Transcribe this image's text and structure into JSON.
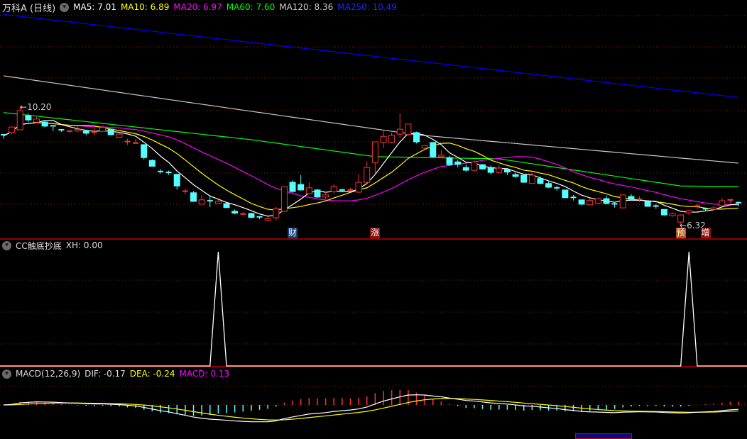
{
  "header": {
    "title": "万科A (日线)",
    "ma5": "MA5: 7.01",
    "ma10": "MA10: 6.89",
    "ma20": "MA20: 6.97",
    "ma60": "MA60: 7.60",
    "ma120": "MA120: 8.36",
    "ma250": "MA250: 10.49"
  },
  "indicator": {
    "title": "CC触底抄底",
    "xh": "XH: 0.00"
  },
  "macd": {
    "title": "MACD(12,26,9)",
    "dif": "DIF: -0.17",
    "dea": "DEA: -0.24",
    "macd": "MACD: 0.13"
  },
  "annotations": {
    "high": "10.20",
    "low": "6.32"
  },
  "event_tags": [
    {
      "text": "财",
      "index": 35,
      "color": "#14417a"
    },
    {
      "text": "涨",
      "index": 45,
      "color": "#8a1010"
    },
    {
      "text": "预",
      "index": 82,
      "color": "#b8520c"
    },
    {
      "text": "增",
      "index": 85,
      "color": "#8a1010"
    }
  ],
  "colors": {
    "up": "#ff3232",
    "down": "#54ffff",
    "ma5": "#ffffff",
    "ma10": "#ffff00",
    "ma20": "#ff00ff",
    "ma60": "#00ff00",
    "ma120": "#c8c8c8",
    "ma250": "#0000ff",
    "grid": "#8b1a1a"
  },
  "chart_data": {
    "type": "candlestick",
    "candles_ohlc": [
      [
        9.28,
        9.3,
        9.15,
        9.24
      ],
      [
        9.35,
        9.55,
        9.3,
        9.53
      ],
      [
        9.44,
        10.2,
        9.42,
        10.06
      ],
      [
        9.9,
        9.97,
        9.7,
        9.76
      ],
      [
        9.69,
        9.85,
        9.67,
        9.79
      ],
      [
        9.69,
        9.76,
        9.52,
        9.56
      ],
      [
        9.57,
        9.57,
        9.4,
        9.55
      ],
      [
        9.44,
        9.47,
        9.37,
        9.4
      ],
      [
        9.36,
        9.41,
        9.33,
        9.4
      ],
      [
        9.4,
        9.55,
        9.38,
        9.45
      ],
      [
        9.4,
        9.42,
        9.26,
        9.33
      ],
      [
        9.33,
        9.5,
        9.28,
        9.37
      ],
      [
        9.39,
        9.56,
        9.38,
        9.52
      ],
      [
        9.46,
        9.46,
        9.26,
        9.28
      ],
      [
        9.2,
        9.33,
        9.19,
        9.3
      ],
      [
        9.04,
        9.15,
        8.95,
        9.06
      ],
      [
        8.99,
        9.15,
        8.99,
        9.01
      ],
      [
        8.96,
        8.96,
        8.48,
        8.54
      ],
      [
        8.45,
        8.48,
        8.26,
        8.26
      ],
      [
        8.09,
        8.17,
        8.02,
        8.07
      ],
      [
        8.06,
        8.12,
        7.98,
        8.04
      ],
      [
        8.0,
        8.0,
        7.5,
        7.62
      ],
      [
        7.43,
        7.53,
        7.35,
        7.45
      ],
      [
        7.4,
        7.45,
        7.12,
        7.12
      ],
      [
        7.03,
        7.32,
        7.03,
        7.17
      ],
      [
        7.14,
        7.32,
        6.93,
        7.11
      ],
      [
        7.05,
        7.18,
        7.05,
        7.12
      ],
      [
        7.05,
        7.05,
        6.9,
        6.92
      ],
      [
        6.8,
        6.86,
        6.7,
        6.74
      ],
      [
        6.69,
        6.78,
        6.69,
        6.71
      ],
      [
        6.73,
        6.75,
        6.58,
        6.6
      ],
      [
        6.62,
        6.64,
        6.54,
        6.6
      ],
      [
        6.5,
        6.62,
        6.5,
        6.56
      ],
      [
        6.59,
        6.95,
        6.5,
        6.88
      ],
      [
        6.8,
        7.6,
        6.78,
        7.6
      ],
      [
        7.74,
        7.8,
        7.4,
        7.44
      ],
      [
        7.67,
        7.97,
        7.47,
        7.49
      ],
      [
        7.37,
        7.74,
        7.35,
        7.56
      ],
      [
        7.49,
        7.53,
        7.24,
        7.26
      ],
      [
        7.26,
        7.42,
        7.2,
        7.33
      ],
      [
        7.44,
        7.67,
        7.37,
        7.6
      ],
      [
        7.49,
        7.53,
        7.42,
        7.46
      ],
      [
        7.47,
        7.56,
        7.44,
        7.49
      ],
      [
        7.42,
        8.0,
        7.4,
        7.74
      ],
      [
        7.74,
        8.42,
        7.7,
        8.22
      ],
      [
        8.38,
        9.05,
        8.0,
        9.05
      ],
      [
        9.03,
        9.45,
        8.85,
        9.23
      ],
      [
        9.03,
        9.35,
        9.0,
        9.26
      ],
      [
        9.3,
        9.97,
        9.18,
        9.46
      ],
      [
        9.29,
        9.63,
        9.25,
        9.63
      ],
      [
        9.35,
        9.38,
        9.0,
        9.05
      ],
      [
        8.85,
        8.93,
        8.78,
        8.93
      ],
      [
        9.03,
        9.03,
        8.54,
        8.57
      ],
      [
        8.57,
        8.78,
        8.55,
        8.62
      ],
      [
        8.54,
        8.6,
        8.27,
        8.31
      ],
      [
        8.4,
        8.48,
        8.22,
        8.32
      ],
      [
        8.22,
        8.32,
        8.08,
        8.13
      ],
      [
        8.13,
        8.47,
        8.1,
        8.4
      ],
      [
        8.31,
        8.33,
        8.15,
        8.17
      ],
      [
        8.22,
        8.28,
        7.99,
        8.06
      ],
      [
        8.06,
        8.3,
        8.02,
        8.2
      ],
      [
        8.15,
        8.2,
        7.97,
        8.07
      ],
      [
        7.99,
        8.05,
        7.88,
        7.93
      ],
      [
        7.97,
        7.97,
        7.72,
        7.74
      ],
      [
        7.7,
        8.05,
        7.7,
        7.97
      ],
      [
        7.86,
        7.92,
        7.68,
        7.7
      ],
      [
        7.7,
        7.76,
        7.55,
        7.58
      ],
      [
        7.56,
        7.62,
        7.47,
        7.53
      ],
      [
        7.49,
        7.49,
        7.24,
        7.24
      ],
      [
        7.25,
        7.33,
        7.15,
        7.23
      ],
      [
        7.17,
        7.17,
        6.99,
        7.03
      ],
      [
        7.01,
        7.22,
        6.99,
        7.15
      ],
      [
        7.06,
        7.24,
        7.04,
        7.21
      ],
      [
        7.21,
        7.31,
        7.03,
        7.05
      ],
      [
        7.04,
        7.1,
        6.92,
        7.02
      ],
      [
        6.91,
        7.35,
        6.91,
        7.33
      ],
      [
        7.28,
        7.36,
        7.15,
        7.19
      ],
      [
        7.17,
        7.29,
        7.1,
        7.19
      ],
      [
        7.12,
        7.12,
        6.96,
        6.96
      ],
      [
        6.97,
        7.03,
        6.88,
        6.95
      ],
      [
        6.86,
        6.86,
        6.66,
        6.68
      ],
      [
        6.66,
        6.76,
        6.62,
        6.72
      ],
      [
        6.45,
        6.7,
        6.32,
        6.68
      ],
      [
        6.75,
        6.85,
        6.68,
        6.82
      ],
      [
        6.95,
        7.06,
        6.88,
        6.97
      ],
      [
        6.88,
        6.92,
        6.82,
        6.86
      ],
      [
        6.86,
        6.96,
        6.82,
        6.91
      ],
      [
        6.98,
        7.24,
        6.98,
        7.14
      ],
      [
        7.16,
        7.17,
        7.07,
        7.17
      ],
      [
        7.08,
        7.12,
        6.96,
        7.07
      ]
    ],
    "ma60_points": [
      [
        0,
        10.0
      ],
      [
        30,
        9.12
      ],
      [
        45,
        8.57
      ],
      [
        60,
        8.5
      ],
      [
        82,
        7.62
      ],
      [
        89,
        7.6
      ]
    ],
    "ma120_points": [
      [
        0,
        11.19
      ],
      [
        30,
        10.04
      ],
      [
        50,
        9.28
      ],
      [
        89,
        8.36
      ]
    ],
    "ma250_points": [
      [
        0,
        13.18
      ],
      [
        89,
        10.49
      ]
    ],
    "signal_xh": {
      "spike_indices": [
        26,
        83
      ],
      "range": [
        0,
        1
      ]
    }
  }
}
